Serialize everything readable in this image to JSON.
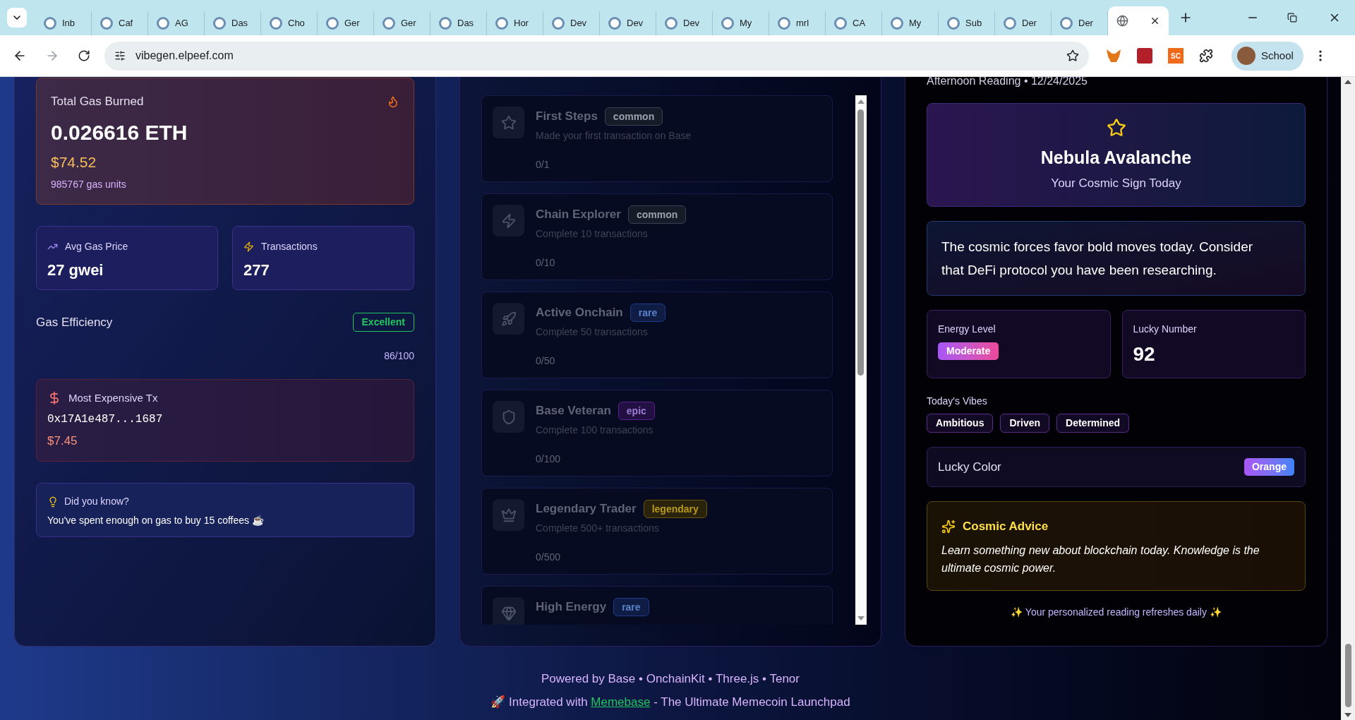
{
  "browser": {
    "tabs": [
      {
        "label": "Inb",
        "selected": false
      },
      {
        "label": "Caf",
        "selected": false
      },
      {
        "label": "AG",
        "selected": false
      },
      {
        "label": "Das",
        "selected": false
      },
      {
        "label": "Cho",
        "selected": false
      },
      {
        "label": "Ger",
        "selected": false
      },
      {
        "label": "Ger",
        "selected": false
      },
      {
        "label": "Das",
        "selected": false
      },
      {
        "label": "Hor",
        "selected": false
      },
      {
        "label": "Dev",
        "selected": false
      },
      {
        "label": "Dev",
        "selected": false
      },
      {
        "label": "Dev",
        "selected": false
      },
      {
        "label": "My",
        "selected": false
      },
      {
        "label": "mrl",
        "selected": false
      },
      {
        "label": "CA",
        "selected": false
      },
      {
        "label": "My",
        "selected": false
      },
      {
        "label": "Sub",
        "selected": false
      },
      {
        "label": "Der",
        "selected": false
      },
      {
        "label": "Der",
        "selected": false
      },
      {
        "selected": true
      }
    ],
    "address": "vibegen.elpeef.com",
    "extension_badge": "SC",
    "profile": "School"
  },
  "gas": {
    "total": {
      "label": "Total Gas Burned",
      "value": "0.026616 ETH",
      "usd": "$74.52",
      "units": "985767 gas units"
    },
    "stats": [
      {
        "label": "Avg Gas Price",
        "value": "27 gwei"
      },
      {
        "label": "Transactions",
        "value": "277"
      }
    ],
    "efficiency": {
      "label": "Gas Efficiency",
      "badge": "Excellent",
      "score": "86/100"
    },
    "expensive": {
      "label": "Most Expensive Tx",
      "hash": "0x17A1e487...1687",
      "usd": "$7.45"
    },
    "tip": {
      "title": "Did you know?",
      "text": "You've spent enough on gas to buy 15 coffees ☕"
    }
  },
  "achievements": [
    {
      "title": "First Steps",
      "rarity": "common",
      "description": "Made your first transaction on Base",
      "progress": "0/1",
      "unlocked": false
    },
    {
      "title": "Chain Explorer",
      "rarity": "common",
      "description": "Complete 10 transactions",
      "progress": "0/10",
      "unlocked": false
    },
    {
      "title": "Active Onchain",
      "rarity": "rare",
      "description": "Complete 50 transactions",
      "progress": "0/50",
      "unlocked": false
    },
    {
      "title": "Base Veteran",
      "rarity": "epic",
      "description": "Complete 100 transactions",
      "progress": "0/100",
      "unlocked": false
    },
    {
      "title": "Legendary Trader",
      "rarity": "legendary",
      "description": "Complete 500+ transactions",
      "progress": "0/500",
      "unlocked": false
    },
    {
      "title": "High Energy",
      "rarity": "rare"
    }
  ],
  "reading": {
    "heading": "Afternoon Reading • 12/24/2025",
    "sign": {
      "name": "Nebula Avalanche",
      "subtitle": "Your Cosmic Sign Today"
    },
    "message": "The cosmic forces favor bold moves today. Consider that DeFi protocol you have been researching.",
    "energy": {
      "label": "Energy Level",
      "value": "Moderate"
    },
    "lucky_number": {
      "label": "Lucky Number",
      "value": "92"
    },
    "vibes": {
      "label": "Today's Vibes",
      "items": [
        "Ambitious",
        "Driven",
        "Determined"
      ]
    },
    "lucky_color": {
      "label": "Lucky Color",
      "value": "Orange"
    },
    "advice": {
      "title": "Cosmic Advice",
      "text": "Learn something new about blockchain today. Knowledge is the ultimate cosmic power."
    },
    "footer": "✨ Your personalized reading refreshes daily ✨"
  },
  "footer": {
    "line1": "Powered by Base • OnchainKit • Three.js • Tenor",
    "line2_before": "🚀 Integrated with",
    "link": "Memebase",
    "line2_after": "- The Ultimate Memecoin Launchpad"
  }
}
